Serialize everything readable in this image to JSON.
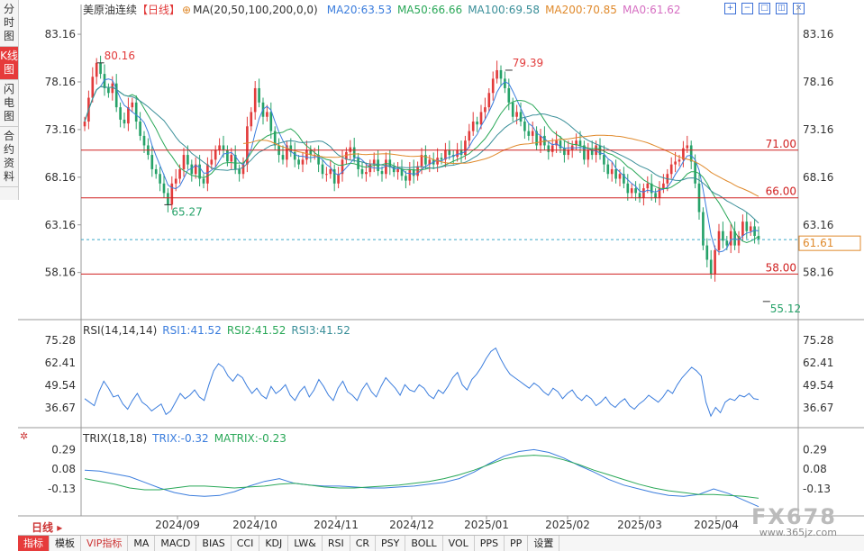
{
  "side_tabs": [
    {
      "label": "分时图",
      "active": false
    },
    {
      "label": "K线图",
      "active": true
    },
    {
      "label": "闪电图",
      "active": false
    },
    {
      "label": "合约资料",
      "active": false
    }
  ],
  "header": {
    "symbol": "美原油连续",
    "period_tag": "【日线】",
    "ma_params": "MA(20,50,100,200,0,0)",
    "ma20": "MA20:63.53",
    "ma50": "MA50:66.66",
    "ma100": "MA100:69.58",
    "ma200": "MA200:70.85",
    "ma0": "MA0:61.62"
  },
  "toolbar_icons": [
    "zoom-in-icon",
    "zoom-out-icon",
    "fullscreen-icon",
    "settings-icon",
    "close-icon"
  ],
  "rsi_header": {
    "params": "RSI(14,14,14)",
    "rsi1": "RSI1:41.52",
    "rsi2": "RSI2:41.52",
    "rsi3": "RSI3:41.52"
  },
  "trix_header": {
    "params": "TRIX(18,18)",
    "trix": "TRIX:-0.32",
    "matrix": "MATRIX:-0.23"
  },
  "period_label": "日线",
  "bottom_bar": [
    {
      "label": "指标",
      "active": true
    },
    {
      "label": "模板"
    },
    {
      "label": "VIP指标",
      "vip": true
    },
    {
      "label": "MA"
    },
    {
      "label": "MACD"
    },
    {
      "label": "BIAS"
    },
    {
      "label": "CCI"
    },
    {
      "label": "KDJ"
    },
    {
      "label": "LW&"
    },
    {
      "label": "RSI"
    },
    {
      "label": "CR"
    },
    {
      "label": "PSY"
    },
    {
      "label": "BOLL"
    },
    {
      "label": "VOL"
    },
    {
      "label": "PPS"
    },
    {
      "label": "PP"
    },
    {
      "label": "设置"
    }
  ],
  "watermark": {
    "logo": "FX678",
    "url": "www.365jz.com"
  },
  "colors": {
    "up": "#e23b3b",
    "down": "#26a269",
    "ma20": "#3b7ddd",
    "ma50": "#2aa858",
    "ma100": "#3a8f99",
    "ma200": "#e08a2c",
    "ma0": "#d66fc2",
    "hline": "#d02020",
    "dashed": "#3aa6c7"
  },
  "chart_data": [
    {
      "type": "candlestick",
      "name": "main",
      "ylim": [
        53.5,
        86.0
      ],
      "yticks": [
        "83.16",
        "78.16",
        "73.16",
        "68.16",
        "63.16",
        "58.16"
      ],
      "xticks": [
        "2024/09",
        "2024/10",
        "2024/11",
        "2024/12",
        "2025/01",
        "2025/02",
        "2025/03",
        "2025/04"
      ],
      "close_series": [
        74.0,
        76.5,
        78.7,
        80.16,
        79.0,
        77.5,
        77.0,
        78.0,
        75.5,
        74.2,
        73.8,
        75.5,
        76.0,
        74.0,
        72.5,
        71.5,
        70.5,
        69.0,
        68.5,
        67.5,
        66.5,
        65.27,
        67.5,
        68.0,
        69.0,
        70.5,
        69.5,
        68.5,
        69.5,
        68.0,
        67.5,
        69.5,
        70.0,
        71.0,
        71.5,
        71.0,
        69.8,
        70.5,
        69.0,
        68.5,
        69.5,
        73.5,
        75.0,
        77.5,
        76.0,
        74.5,
        75.0,
        73.0,
        71.5,
        70.5,
        70.0,
        71.5,
        70.8,
        70.0,
        69.5,
        70.0,
        71.0,
        70.5,
        70.5,
        69.5,
        68.5,
        68.5,
        69.0,
        67.5,
        68.5,
        70.0,
        70.8,
        71.3,
        70.2,
        69.0,
        68.5,
        68.7,
        69.5,
        70.0,
        68.8,
        68.5,
        70.0,
        69.2,
        68.7,
        69.0,
        68.3,
        67.8,
        69.0,
        68.3,
        69.3,
        70.5,
        69.5,
        70.0,
        69.5,
        70.2,
        70.0,
        71.0,
        70.5,
        70.3,
        71.0,
        70.5,
        72.0,
        73.0,
        74.0,
        73.7,
        75.0,
        75.5,
        77.0,
        78.5,
        79.39,
        78.5,
        77.5,
        76.0,
        74.5,
        75.0,
        74.0,
        73.0,
        72.5,
        73.0,
        71.5,
        72.5,
        71.5,
        70.8,
        71.5,
        72.0,
        71.2,
        70.5,
        71.0,
        71.5,
        72.0,
        71.5,
        70.0,
        71.0,
        70.5,
        71.5,
        70.5,
        69.5,
        68.5,
        69.0,
        68.0,
        68.5,
        67.5,
        66.5,
        67.0,
        66.5,
        66.0,
        67.0,
        67.5,
        66.5,
        66.0,
        67.0,
        67.5,
        68.5,
        69.5,
        69.8,
        70.0,
        71.2,
        71.5,
        69.8,
        67.5,
        64.5,
        61.0,
        59.5,
        58.0,
        60.5,
        62.5,
        61.5,
        61.0,
        62.5,
        61.0,
        62.0,
        63.5,
        62.5,
        63.0,
        62.0,
        61.61
      ],
      "annotations": [
        {
          "label": "80.16",
          "value": 80.16,
          "kind": "high"
        },
        {
          "label": "65.27",
          "value": 65.27,
          "kind": "low"
        },
        {
          "label": "79.39",
          "value": 79.39,
          "kind": "high"
        },
        {
          "label": "55.12",
          "value": 55.12,
          "kind": "low"
        }
      ],
      "hlines": [
        {
          "label": "71.00",
          "value": 71.0
        },
        {
          "label": "66.00",
          "value": 66.0
        },
        {
          "label": "58.00",
          "value": 58.0
        }
      ],
      "last_price": {
        "label": "61.61",
        "value": 61.61
      }
    },
    {
      "type": "line",
      "name": "RSI",
      "ylim": [
        28.0,
        78.5
      ],
      "yticks": [
        "75.28",
        "62.41",
        "49.54",
        "36.67"
      ],
      "series": [
        {
          "name": "RSI1",
          "values": [
            42,
            40,
            38,
            46,
            52,
            48,
            43,
            44,
            39,
            36,
            41,
            45,
            40,
            38,
            35,
            37,
            39,
            33,
            35,
            40,
            45,
            42,
            44,
            47,
            43,
            41,
            50,
            58,
            62,
            60,
            55,
            52,
            56,
            54,
            49,
            45,
            48,
            44,
            42,
            49,
            45,
            47,
            50,
            44,
            41,
            46,
            49,
            43,
            47,
            53,
            49,
            44,
            41,
            48,
            52,
            46,
            44,
            41,
            47,
            51,
            46,
            43,
            49,
            54,
            51,
            48,
            44,
            50,
            47,
            46,
            50,
            48,
            44,
            42,
            47,
            45,
            49,
            54,
            57,
            50,
            47,
            53,
            56,
            60,
            65,
            69,
            71,
            65,
            60,
            56,
            54,
            52,
            50,
            48,
            51,
            49,
            46,
            44,
            48,
            46,
            42,
            45,
            47,
            43,
            41,
            44,
            42,
            38,
            40,
            43,
            39,
            37,
            40,
            42,
            38,
            36,
            39,
            41,
            44,
            42,
            40,
            43,
            47,
            45,
            50,
            54,
            57,
            60,
            58,
            55,
            40,
            32,
            37,
            34,
            40,
            42,
            41,
            44,
            43,
            45,
            42,
            41.52
          ]
        }
      ]
    },
    {
      "type": "line",
      "name": "TRIX",
      "ylim": [
        -0.4,
        0.4
      ],
      "yticks": [
        "0.29",
        "0.08",
        "-0.13"
      ],
      "series": [
        {
          "name": "TRIX",
          "values": [
            0.07,
            0.06,
            0.03,
            0.0,
            -0.06,
            -0.12,
            -0.17,
            -0.2,
            -0.21,
            -0.2,
            -0.16,
            -0.1,
            -0.05,
            -0.02,
            -0.07,
            -0.09,
            -0.1,
            -0.1,
            -0.11,
            -0.12,
            -0.12,
            -0.11,
            -0.1,
            -0.08,
            -0.06,
            -0.02,
            0.05,
            0.14,
            0.22,
            0.27,
            0.29,
            0.26,
            0.2,
            0.12,
            0.05,
            -0.03,
            -0.09,
            -0.13,
            -0.17,
            -0.2,
            -0.21,
            -0.19,
            -0.13,
            -0.18,
            -0.25,
            -0.32
          ]
        },
        {
          "name": "MATRIX",
          "values": [
            -0.02,
            -0.05,
            -0.08,
            -0.12,
            -0.14,
            -0.14,
            -0.12,
            -0.1,
            -0.1,
            -0.11,
            -0.12,
            -0.11,
            -0.1,
            -0.08,
            -0.07,
            -0.09,
            -0.11,
            -0.12,
            -0.12,
            -0.11,
            -0.1,
            -0.09,
            -0.07,
            -0.05,
            -0.02,
            0.02,
            0.07,
            0.13,
            0.19,
            0.22,
            0.23,
            0.22,
            0.18,
            0.13,
            0.07,
            0.02,
            -0.03,
            -0.08,
            -0.12,
            -0.15,
            -0.17,
            -0.19,
            -0.19,
            -0.2,
            -0.21,
            -0.23
          ]
        }
      ]
    }
  ]
}
